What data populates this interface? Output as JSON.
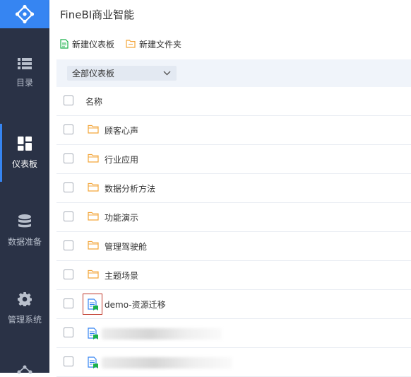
{
  "app": {
    "title": "FineBI商业智能"
  },
  "sidebar": {
    "items": [
      {
        "label": "目录",
        "icon": "list-icon"
      },
      {
        "label": "仪表板",
        "icon": "dashboard-icon",
        "active": true
      },
      {
        "label": "数据准备",
        "icon": "database-icon"
      },
      {
        "label": "管理系统",
        "icon": "gear-icon"
      }
    ]
  },
  "toolbar": {
    "new_dashboard": "新建仪表板",
    "new_folder": "新建文件夹"
  },
  "filter": {
    "selected": "全部仪表板"
  },
  "table": {
    "header": "名称",
    "rows": [
      {
        "type": "folder",
        "name": "顾客心声"
      },
      {
        "type": "folder",
        "name": "行业应用"
      },
      {
        "type": "folder",
        "name": "数据分析方法"
      },
      {
        "type": "folder",
        "name": "功能演示"
      },
      {
        "type": "folder",
        "name": "管理驾驶舱"
      },
      {
        "type": "folder",
        "name": "主题场景"
      },
      {
        "type": "dashboard",
        "name": "demo-资源迁移"
      }
    ]
  },
  "colors": {
    "sidebar_bg": "#2a3246",
    "logo_bg": "#3685f2",
    "folder": "#f3a63b",
    "dashboard": "#3685f2",
    "badge": "#1ab14a"
  }
}
